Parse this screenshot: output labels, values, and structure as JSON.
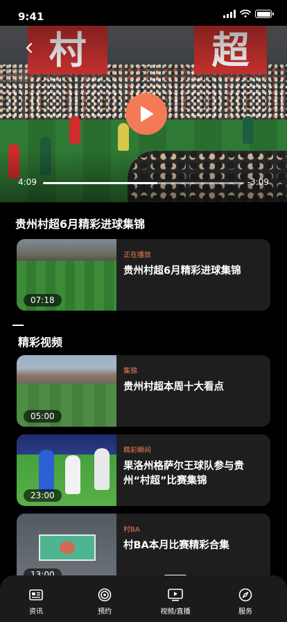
{
  "status_bar": {
    "time": "9:41"
  },
  "player": {
    "banner_left": "村",
    "banner_right": "超",
    "current_time": "4:09",
    "remaining_time": "-3:09",
    "progress": 0.57
  },
  "video_title": "贵州村超6月精彩进球集锦",
  "now_playing": {
    "tag": "正在播放",
    "title": "贵州村超6月精彩进球集锦",
    "duration": "07:18"
  },
  "section": {
    "title": "精彩视频"
  },
  "videos": [
    {
      "tag": "集锦",
      "title": "贵州村超本周十大看点",
      "duration": "05:00"
    },
    {
      "tag": "精彩瞬间",
      "title": "果洛州格萨尔王球队参与贵州“村超”比赛集锦",
      "duration": "23:00"
    },
    {
      "tag": "村BA",
      "title": "村BA本月比赛精彩合集",
      "duration": "13:00"
    }
  ],
  "tabbar": {
    "items": [
      {
        "label": "资讯",
        "icon": "news-icon"
      },
      {
        "label": "预约",
        "icon": "target-icon"
      },
      {
        "label": "视频/直播",
        "icon": "video-play-icon"
      },
      {
        "label": "服务",
        "icon": "compass-icon"
      }
    ]
  },
  "colors": {
    "accent": "#f47a55",
    "background": "#000000",
    "card": "#1e1e1e"
  }
}
